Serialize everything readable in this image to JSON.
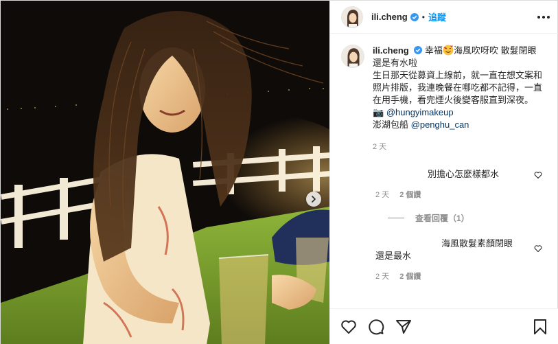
{
  "post": {
    "username": "ili.cheng",
    "follow_label": "追蹤",
    "dot": "•"
  },
  "caption": {
    "username": "ili.cheng",
    "line1_a": "幸福",
    "line1_b": "海風吹呀吹 散髮閉眼還是有水啦",
    "paragraph": "生日那天從募資上線前，就一直在想文案和照片排版，我連晚餐在哪吃都不記得，一直在用手機，看完煙火後變客服直到深夜。",
    "camera_prefix": "📷",
    "camera_mention": "@hungyimakeup",
    "boat_prefix": "澎湖包船",
    "boat_mention": "@penghu_can",
    "time": "2 天"
  },
  "comments": [
    {
      "text": "別擔心怎麼樣都水",
      "time": "2 天",
      "likes": "2 個讚",
      "view_replies": "查看回覆（1）"
    },
    {
      "text": "海風散髮素顏閉眼還是最水",
      "time": "2 天",
      "likes": "2 個讚"
    }
  ],
  "icons": {
    "header_more": "more-horizontal-icon",
    "verified": "verified-badge-icon",
    "next": "chevron-right-icon",
    "like": "heart-icon",
    "comment": "comment-icon",
    "share": "share-icon",
    "save": "bookmark-icon"
  },
  "colors": {
    "accent": "#0095f6",
    "verified": "#3897f0",
    "link": "#00376b",
    "muted": "#8e8e8e"
  }
}
